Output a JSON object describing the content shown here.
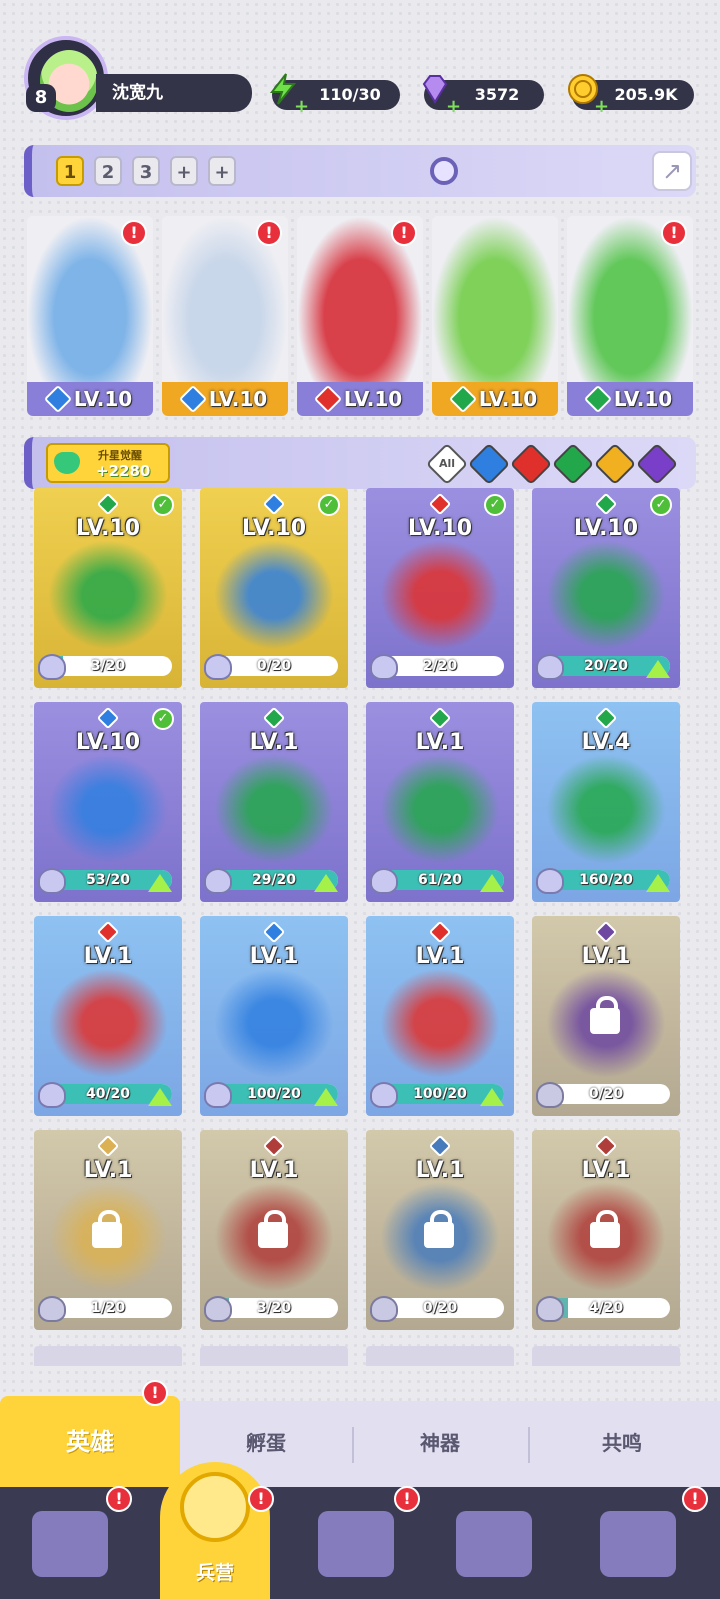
{
  "player": {
    "level": "8",
    "name": "沈宽九"
  },
  "resources": {
    "energy": "110/30",
    "gems": "3572",
    "coins": "205.9K"
  },
  "team": {
    "slots": [
      "1",
      "2",
      "3",
      "+",
      "+"
    ],
    "active_slot": "1",
    "members": [
      {
        "level": "LV.10",
        "element": "water"
      },
      {
        "level": "LV.10",
        "element": "water"
      },
      {
        "level": "LV.10",
        "element": "fire"
      },
      {
        "level": "LV.10",
        "element": "wind"
      },
      {
        "level": "LV.10",
        "element": "wind"
      }
    ]
  },
  "filter": {
    "star_label": "升星觉醒",
    "star_value": "+2280",
    "all_label": "All",
    "elements": [
      "water",
      "fire",
      "wind",
      "light",
      "dark"
    ]
  },
  "heroes": [
    {
      "level": "LV.10",
      "element": "wind",
      "progress": "3/20",
      "fraction": 0.15,
      "checked": true,
      "locked": false,
      "upgrade": false,
      "bg": "gold"
    },
    {
      "level": "LV.10",
      "element": "water",
      "progress": "0/20",
      "fraction": 0.0,
      "checked": true,
      "locked": false,
      "upgrade": false,
      "bg": "gold"
    },
    {
      "level": "LV.10",
      "element": "fire",
      "progress": "2/20",
      "fraction": 0.1,
      "checked": true,
      "locked": false,
      "upgrade": false,
      "bg": "purple"
    },
    {
      "level": "LV.10",
      "element": "wind",
      "progress": "20/20",
      "fraction": 1.0,
      "checked": true,
      "locked": false,
      "upgrade": true,
      "bg": "purple"
    },
    {
      "level": "LV.10",
      "element": "water",
      "progress": "53/20",
      "fraction": 1.0,
      "checked": true,
      "locked": false,
      "upgrade": true,
      "bg": "purple"
    },
    {
      "level": "LV.1",
      "element": "wind",
      "progress": "29/20",
      "fraction": 1.0,
      "checked": false,
      "locked": false,
      "upgrade": true,
      "bg": "purple"
    },
    {
      "level": "LV.1",
      "element": "wind",
      "progress": "61/20",
      "fraction": 1.0,
      "checked": false,
      "locked": false,
      "upgrade": true,
      "bg": "purple"
    },
    {
      "level": "LV.4",
      "element": "wind",
      "progress": "160/20",
      "fraction": 1.0,
      "checked": false,
      "locked": false,
      "upgrade": true,
      "bg": "blue"
    },
    {
      "level": "LV.1",
      "element": "fire",
      "progress": "40/20",
      "fraction": 1.0,
      "checked": false,
      "locked": false,
      "upgrade": true,
      "bg": "blue"
    },
    {
      "level": "LV.1",
      "element": "water",
      "progress": "100/20",
      "fraction": 1.0,
      "checked": false,
      "locked": false,
      "upgrade": true,
      "bg": "blue"
    },
    {
      "level": "LV.1",
      "element": "fire",
      "progress": "100/20",
      "fraction": 1.0,
      "checked": false,
      "locked": false,
      "upgrade": true,
      "bg": "blue"
    },
    {
      "level": "LV.1",
      "element": "dark",
      "progress": "0/20",
      "fraction": 0.0,
      "checked": false,
      "locked": true,
      "upgrade": false,
      "bg": "goldlock"
    },
    {
      "level": "LV.1",
      "element": "light",
      "progress": "1/20",
      "fraction": 0.05,
      "checked": false,
      "locked": true,
      "upgrade": false,
      "bg": "goldlock"
    },
    {
      "level": "LV.1",
      "element": "fire",
      "progress": "3/20",
      "fraction": 0.15,
      "checked": false,
      "locked": true,
      "upgrade": false,
      "bg": "goldlock"
    },
    {
      "level": "LV.1",
      "element": "water",
      "progress": "0/20",
      "fraction": 0.0,
      "checked": false,
      "locked": true,
      "upgrade": false,
      "bg": "goldlock"
    },
    {
      "level": "LV.1",
      "element": "fire",
      "progress": "4/20",
      "fraction": 0.2,
      "checked": false,
      "locked": true,
      "upgrade": false,
      "bg": "goldlock"
    }
  ],
  "subtabs": [
    "英雄",
    "孵蛋",
    "神器",
    "共鸣"
  ],
  "nav": {
    "active_label": "兵营"
  },
  "colors": {
    "water": "#2f7fe0",
    "fire": "#e0302c",
    "wind": "#22a84a",
    "light": "#f0b020",
    "dark": "#7a3fc8",
    "gold": "#e9c441",
    "purple": "#8a7fd8",
    "blue": "#8fb6ee",
    "goldlock": "#c9b890"
  }
}
